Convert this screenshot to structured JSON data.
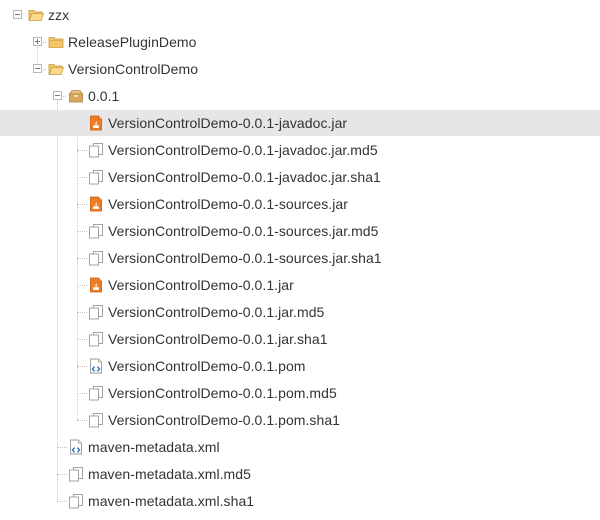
{
  "tree": {
    "root": {
      "label": "zzx",
      "icon": "folder-open-icon",
      "state": "expanded"
    },
    "release_plugin": {
      "label": "ReleasePluginDemo",
      "icon": "folder-icon",
      "state": "collapsed"
    },
    "version_control": {
      "label": "VersionControlDemo",
      "icon": "folder-open-icon",
      "state": "expanded"
    },
    "version": {
      "label": "0.0.1",
      "icon": "package-icon",
      "state": "expanded"
    },
    "files": [
      {
        "label": "VersionControlDemo-0.0.1-javadoc.jar",
        "icon": "jar-file-icon",
        "selected": true
      },
      {
        "label": "VersionControlDemo-0.0.1-javadoc.jar.md5",
        "icon": "checksum-file-icon"
      },
      {
        "label": "VersionControlDemo-0.0.1-javadoc.jar.sha1",
        "icon": "checksum-file-icon"
      },
      {
        "label": "VersionControlDemo-0.0.1-sources.jar",
        "icon": "jar-file-icon"
      },
      {
        "label": "VersionControlDemo-0.0.1-sources.jar.md5",
        "icon": "checksum-file-icon"
      },
      {
        "label": "VersionControlDemo-0.0.1-sources.jar.sha1",
        "icon": "checksum-file-icon"
      },
      {
        "label": "VersionControlDemo-0.0.1.jar",
        "icon": "jar-file-icon"
      },
      {
        "label": "VersionControlDemo-0.0.1.jar.md5",
        "icon": "checksum-file-icon"
      },
      {
        "label": "VersionControlDemo-0.0.1.jar.sha1",
        "icon": "checksum-file-icon"
      },
      {
        "label": "VersionControlDemo-0.0.1.pom",
        "icon": "xml-file-icon"
      },
      {
        "label": "VersionControlDemo-0.0.1.pom.md5",
        "icon": "checksum-file-icon"
      },
      {
        "label": "VersionControlDemo-0.0.1.pom.sha1",
        "icon": "checksum-file-icon"
      }
    ],
    "metadata": [
      {
        "label": "maven-metadata.xml",
        "icon": "xml-file-icon"
      },
      {
        "label": "maven-metadata.xml.md5",
        "icon": "checksum-file-icon"
      },
      {
        "label": "maven-metadata.xml.sha1",
        "icon": "checksum-file-icon"
      }
    ]
  },
  "colors": {
    "selected_row": "#e6e6e6",
    "folder": "#f5c56a",
    "jar": "#f07c24",
    "xml": "#2f77c4",
    "tree_lines": "#c4c4c4"
  }
}
